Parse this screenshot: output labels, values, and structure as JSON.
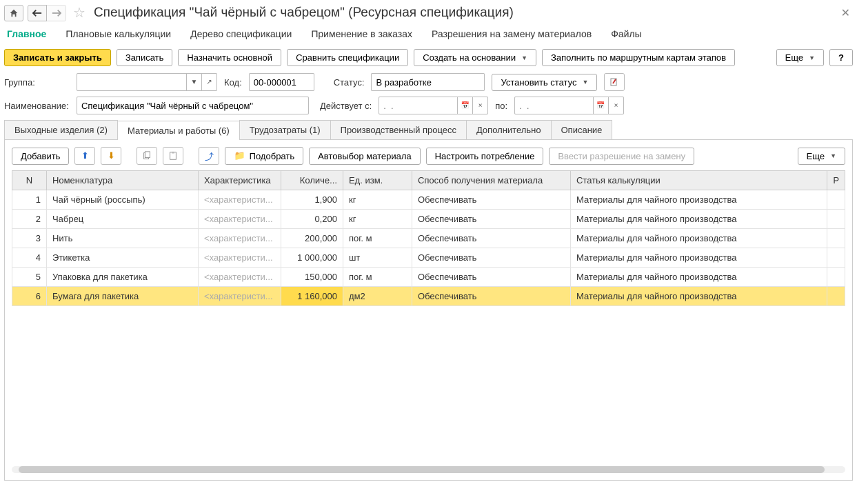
{
  "header": {
    "title": "Спецификация \"Чай чёрный с чабрецом\" (Ресурсная спецификация)"
  },
  "nav": {
    "main": "Главное",
    "plan": "Плановые калькуляции",
    "tree": "Дерево спецификации",
    "orders": "Применение в заказах",
    "permissions": "Разрешения на замену материалов",
    "files": "Файлы"
  },
  "toolbar": {
    "save_close": "Записать и закрыть",
    "save": "Записать",
    "set_main": "Назначить основной",
    "compare": "Сравнить спецификации",
    "create_based": "Создать на основании",
    "fill_by_routes": "Заполнить по маршрутным картам этапов",
    "more": "Еще",
    "help": "?"
  },
  "form": {
    "group_label": "Группа:",
    "code_label": "Код:",
    "code_value": "00-000001",
    "status_label": "Статус:",
    "status_value": "В разработке",
    "set_status": "Установить статус",
    "name_label": "Наименование:",
    "name_value": "Спецификация \"Чай чёрный с чабрецом\"",
    "valid_from_label": "Действует с:",
    "date_placeholder": ".  .",
    "to_label": "по:"
  },
  "subtabs": {
    "out": "Выходные изделия (2)",
    "mat": "Материалы и работы (6)",
    "labor": "Трудозатраты (1)",
    "process": "Производственный процесс",
    "extra": "Дополнительно",
    "desc": "Описание"
  },
  "panel_toolbar": {
    "add": "Добавить",
    "pick": "Подобрать",
    "auto": "Автовыбор материала",
    "consume": "Настроить потребление",
    "permission": "Ввести разрешение на замену",
    "more": "Еще"
  },
  "columns": {
    "n": "N",
    "nom": "Номенклатура",
    "char": "Характеристика",
    "qty": "Количе...",
    "unit": "Ед. изм.",
    "method": "Способ получения материала",
    "article": "Статья калькуляции",
    "last": "Р"
  },
  "char_placeholder": "<характеристи...",
  "rows": [
    {
      "n": "1",
      "nom": "Чай чёрный (россыпь)",
      "qty": "1,900",
      "unit": "кг",
      "method": "Обеспечивать",
      "article": "Материалы для чайного производства"
    },
    {
      "n": "2",
      "nom": "Чабрец",
      "qty": "0,200",
      "unit": "кг",
      "method": "Обеспечивать",
      "article": "Материалы для чайного производства"
    },
    {
      "n": "3",
      "nom": "Нить",
      "qty": "200,000",
      "unit": "пог. м",
      "method": "Обеспечивать",
      "article": "Материалы для чайного производства"
    },
    {
      "n": "4",
      "nom": "Этикетка",
      "qty": "1 000,000",
      "unit": "шт",
      "method": "Обеспечивать",
      "article": "Материалы для чайного производства"
    },
    {
      "n": "5",
      "nom": "Упаковка для пакетика",
      "qty": "150,000",
      "unit": "пог. м",
      "method": "Обеспечивать",
      "article": "Материалы для чайного производства"
    },
    {
      "n": "6",
      "nom": "Бумага для пакетика",
      "qty": "1 160,000",
      "unit": "дм2",
      "method": "Обеспечивать",
      "article": "Материалы для чайного производства"
    }
  ]
}
